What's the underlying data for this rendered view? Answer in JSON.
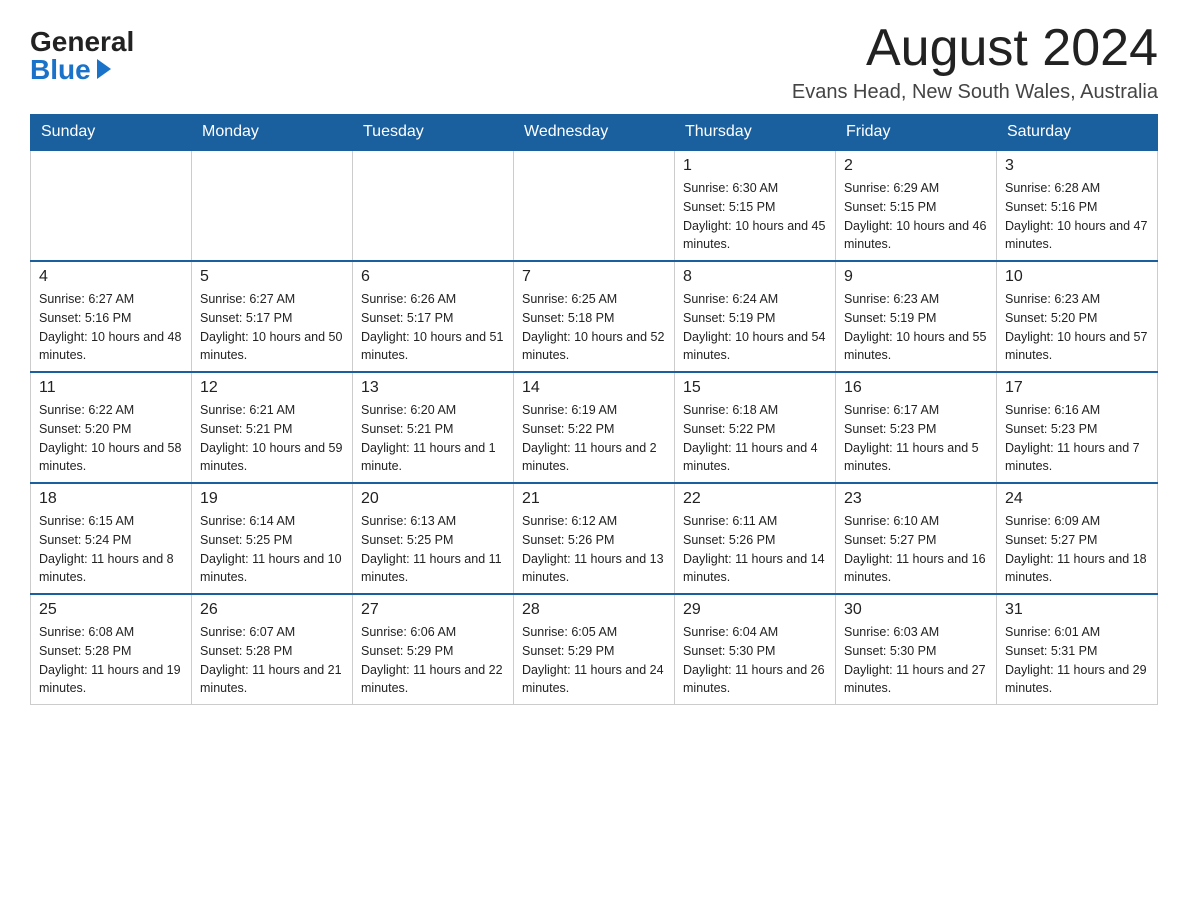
{
  "logo": {
    "general": "General",
    "blue": "Blue"
  },
  "title": "August 2024",
  "location": "Evans Head, New South Wales, Australia",
  "days_of_week": [
    "Sunday",
    "Monday",
    "Tuesday",
    "Wednesday",
    "Thursday",
    "Friday",
    "Saturday"
  ],
  "weeks": [
    [
      {
        "day": "",
        "info": ""
      },
      {
        "day": "",
        "info": ""
      },
      {
        "day": "",
        "info": ""
      },
      {
        "day": "",
        "info": ""
      },
      {
        "day": "1",
        "info": "Sunrise: 6:30 AM\nSunset: 5:15 PM\nDaylight: 10 hours and 45 minutes."
      },
      {
        "day": "2",
        "info": "Sunrise: 6:29 AM\nSunset: 5:15 PM\nDaylight: 10 hours and 46 minutes."
      },
      {
        "day": "3",
        "info": "Sunrise: 6:28 AM\nSunset: 5:16 PM\nDaylight: 10 hours and 47 minutes."
      }
    ],
    [
      {
        "day": "4",
        "info": "Sunrise: 6:27 AM\nSunset: 5:16 PM\nDaylight: 10 hours and 48 minutes."
      },
      {
        "day": "5",
        "info": "Sunrise: 6:27 AM\nSunset: 5:17 PM\nDaylight: 10 hours and 50 minutes."
      },
      {
        "day": "6",
        "info": "Sunrise: 6:26 AM\nSunset: 5:17 PM\nDaylight: 10 hours and 51 minutes."
      },
      {
        "day": "7",
        "info": "Sunrise: 6:25 AM\nSunset: 5:18 PM\nDaylight: 10 hours and 52 minutes."
      },
      {
        "day": "8",
        "info": "Sunrise: 6:24 AM\nSunset: 5:19 PM\nDaylight: 10 hours and 54 minutes."
      },
      {
        "day": "9",
        "info": "Sunrise: 6:23 AM\nSunset: 5:19 PM\nDaylight: 10 hours and 55 minutes."
      },
      {
        "day": "10",
        "info": "Sunrise: 6:23 AM\nSunset: 5:20 PM\nDaylight: 10 hours and 57 minutes."
      }
    ],
    [
      {
        "day": "11",
        "info": "Sunrise: 6:22 AM\nSunset: 5:20 PM\nDaylight: 10 hours and 58 minutes."
      },
      {
        "day": "12",
        "info": "Sunrise: 6:21 AM\nSunset: 5:21 PM\nDaylight: 10 hours and 59 minutes."
      },
      {
        "day": "13",
        "info": "Sunrise: 6:20 AM\nSunset: 5:21 PM\nDaylight: 11 hours and 1 minute."
      },
      {
        "day": "14",
        "info": "Sunrise: 6:19 AM\nSunset: 5:22 PM\nDaylight: 11 hours and 2 minutes."
      },
      {
        "day": "15",
        "info": "Sunrise: 6:18 AM\nSunset: 5:22 PM\nDaylight: 11 hours and 4 minutes."
      },
      {
        "day": "16",
        "info": "Sunrise: 6:17 AM\nSunset: 5:23 PM\nDaylight: 11 hours and 5 minutes."
      },
      {
        "day": "17",
        "info": "Sunrise: 6:16 AM\nSunset: 5:23 PM\nDaylight: 11 hours and 7 minutes."
      }
    ],
    [
      {
        "day": "18",
        "info": "Sunrise: 6:15 AM\nSunset: 5:24 PM\nDaylight: 11 hours and 8 minutes."
      },
      {
        "day": "19",
        "info": "Sunrise: 6:14 AM\nSunset: 5:25 PM\nDaylight: 11 hours and 10 minutes."
      },
      {
        "day": "20",
        "info": "Sunrise: 6:13 AM\nSunset: 5:25 PM\nDaylight: 11 hours and 11 minutes."
      },
      {
        "day": "21",
        "info": "Sunrise: 6:12 AM\nSunset: 5:26 PM\nDaylight: 11 hours and 13 minutes."
      },
      {
        "day": "22",
        "info": "Sunrise: 6:11 AM\nSunset: 5:26 PM\nDaylight: 11 hours and 14 minutes."
      },
      {
        "day": "23",
        "info": "Sunrise: 6:10 AM\nSunset: 5:27 PM\nDaylight: 11 hours and 16 minutes."
      },
      {
        "day": "24",
        "info": "Sunrise: 6:09 AM\nSunset: 5:27 PM\nDaylight: 11 hours and 18 minutes."
      }
    ],
    [
      {
        "day": "25",
        "info": "Sunrise: 6:08 AM\nSunset: 5:28 PM\nDaylight: 11 hours and 19 minutes."
      },
      {
        "day": "26",
        "info": "Sunrise: 6:07 AM\nSunset: 5:28 PM\nDaylight: 11 hours and 21 minutes."
      },
      {
        "day": "27",
        "info": "Sunrise: 6:06 AM\nSunset: 5:29 PM\nDaylight: 11 hours and 22 minutes."
      },
      {
        "day": "28",
        "info": "Sunrise: 6:05 AM\nSunset: 5:29 PM\nDaylight: 11 hours and 24 minutes."
      },
      {
        "day": "29",
        "info": "Sunrise: 6:04 AM\nSunset: 5:30 PM\nDaylight: 11 hours and 26 minutes."
      },
      {
        "day": "30",
        "info": "Sunrise: 6:03 AM\nSunset: 5:30 PM\nDaylight: 11 hours and 27 minutes."
      },
      {
        "day": "31",
        "info": "Sunrise: 6:01 AM\nSunset: 5:31 PM\nDaylight: 11 hours and 29 minutes."
      }
    ]
  ]
}
